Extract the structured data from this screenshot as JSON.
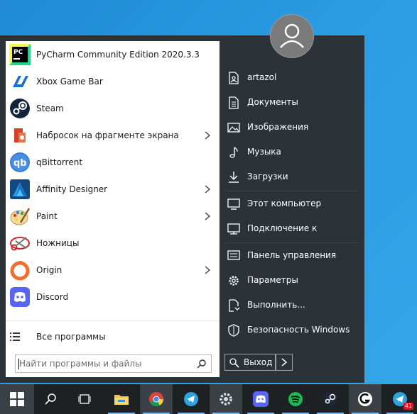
{
  "apps": [
    {
      "label": "PyCharm Community Edition 2020.3.3",
      "icon": "pycharm-icon",
      "submenu": false
    },
    {
      "label": "Xbox Game Bar",
      "icon": "xbox-game-bar-icon",
      "submenu": false
    },
    {
      "label": "Steam",
      "icon": "steam-icon",
      "submenu": false
    },
    {
      "label": "Набросок на фрагменте экрана",
      "icon": "snip-sketch-icon",
      "submenu": true
    },
    {
      "label": "qBittorrent",
      "icon": "qbittorrent-icon",
      "submenu": false
    },
    {
      "label": "Affinity Designer",
      "icon": "affinity-designer-icon",
      "submenu": true
    },
    {
      "label": "Paint",
      "icon": "paint-icon",
      "submenu": true
    },
    {
      "label": "Ножницы",
      "icon": "scissors-icon",
      "submenu": false
    },
    {
      "label": "Origin",
      "icon": "origin-icon",
      "submenu": true
    },
    {
      "label": "Discord",
      "icon": "discord-icon",
      "submenu": false
    }
  ],
  "all_programs": {
    "label": "Все программы"
  },
  "search": {
    "placeholder": "Найти программы и файлы",
    "value": ""
  },
  "right_panel": [
    {
      "label": "artazol",
      "icon": "user-folder-icon"
    },
    {
      "label": "Документы",
      "icon": "documents-icon"
    },
    {
      "label": "Изображения",
      "icon": "pictures-icon"
    },
    {
      "label": "Музыка",
      "icon": "music-icon"
    },
    {
      "label": "Загрузки",
      "icon": "downloads-icon"
    },
    {
      "label": "Этот компьютер",
      "icon": "computer-icon"
    },
    {
      "label": "Подключение к",
      "icon": "connect-icon"
    },
    {
      "label": "Панель управления",
      "icon": "control-panel-icon"
    },
    {
      "label": "Параметры",
      "icon": "settings-icon"
    },
    {
      "label": "Выполнить...",
      "icon": "run-icon"
    },
    {
      "label": "Безопасность Windows",
      "icon": "security-shield-icon"
    }
  ],
  "logout": {
    "label": "Выход",
    "icon": "logout-icon"
  },
  "taskbar": {
    "items": [
      "windows-start-icon",
      "search-icon",
      "task-view-icon",
      "file-explorer-icon",
      "chrome-icon",
      "telegram-icon",
      "settings-icon",
      "video-icon",
      "discord-icon",
      "spotify-icon",
      "steam-icon",
      "logitech-ghub-icon",
      "telegram-icon"
    ],
    "badge": "41"
  },
  "colors": {
    "menu_bg": "#2b3238",
    "left_panel_bg": "#ffffff",
    "taskbar_bg": "#1d2124",
    "desktop": "#2b9be3"
  }
}
